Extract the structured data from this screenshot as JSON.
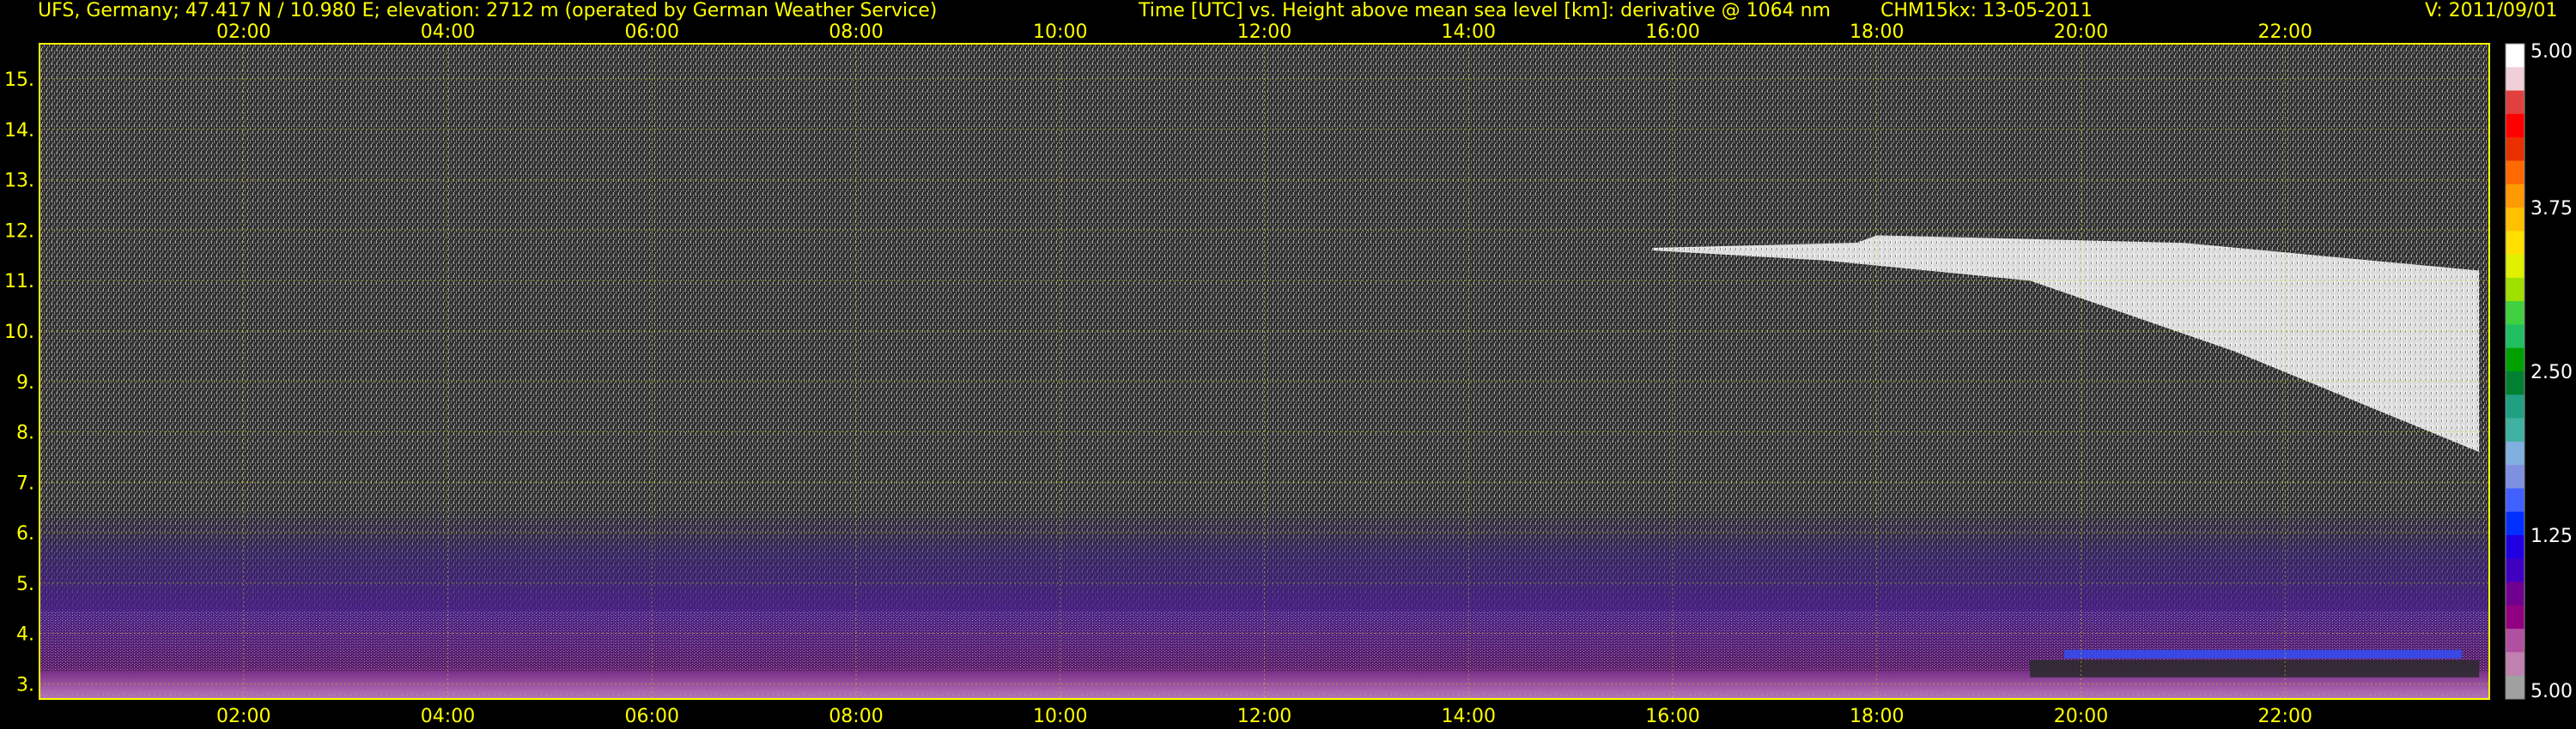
{
  "header": {
    "station": "UFS, Germany; 47.417 N / 10.980 E; elevation: 2712 m  (operated by German Weather Service)",
    "axes": "Time [UTC] vs. Height above mean sea level [km]: derivative @ 1064 nm",
    "instrument": "CHM15kx: 13-05-2011",
    "version": "V: 2011/09/01"
  },
  "colors": {
    "background": "#000000",
    "text": "#ffff00",
    "gridline": "#c8c800",
    "frame": "#ffff00"
  },
  "chart_data": {
    "type": "heatmap",
    "title": "Time [UTC] vs. Height above mean sea level [km]: derivative @ 1064 nm",
    "xlabel": "Time [UTC]",
    "ylabel": "Height above mean sea level [km]",
    "x_ticks": [
      "02:00",
      "04:00",
      "06:00",
      "08:00",
      "10:00",
      "12:00",
      "14:00",
      "16:00",
      "18:00",
      "20:00",
      "22:00"
    ],
    "x_tick_hours": [
      2,
      4,
      6,
      8,
      10,
      12,
      14,
      16,
      18,
      20,
      22
    ],
    "xlim_hours": [
      0,
      24
    ],
    "y_ticks": [
      "3.",
      "4.",
      "5.",
      "6.",
      "7.",
      "8.",
      "9.",
      "10.",
      "11.",
      "12.",
      "13.",
      "14.",
      "15."
    ],
    "y_tick_values": [
      3,
      4,
      5,
      6,
      7,
      8,
      9,
      10,
      11,
      12,
      13,
      14,
      15
    ],
    "ylim_km": [
      2.7,
      15.7
    ],
    "grid": true,
    "colorbar": {
      "tick_labels": [
        "5.00",
        "3.75",
        "2.50",
        "1.25",
        "5.00"
      ],
      "tick_values": [
        5.0,
        3.75,
        2.5,
        1.25,
        0.0
      ],
      "colors_top_to_bottom": [
        "#ffffff",
        "#f0d0d8",
        "#e04040",
        "#ff0000",
        "#e83000",
        "#ff6a00",
        "#ff9a00",
        "#ffc000",
        "#ffe000",
        "#e0f000",
        "#a0e000",
        "#40d040",
        "#20c060",
        "#00a000",
        "#008030",
        "#20a080",
        "#40b0a0",
        "#80b0e0",
        "#8090e0",
        "#4060ff",
        "#0030ff",
        "#2000e0",
        "#4000c0",
        "#700090",
        "#900080",
        "#b050a0",
        "#c080b0",
        "#a0a0a0"
      ]
    },
    "features": [
      {
        "name": "cirrus cloud",
        "start_hour": 15.8,
        "end_hour": 23.9,
        "top_km": 11.9,
        "base_km_start": 11.6,
        "base_km_end": 7.6
      },
      {
        "name": "aerosol layer",
        "start_hour": 0,
        "end_hour": 24,
        "top_km": 6.5,
        "base_km": 2.8
      },
      {
        "name": "low cloud",
        "start_hour": 19.5,
        "end_hour": 23.9,
        "height_km": 3.3
      }
    ]
  }
}
